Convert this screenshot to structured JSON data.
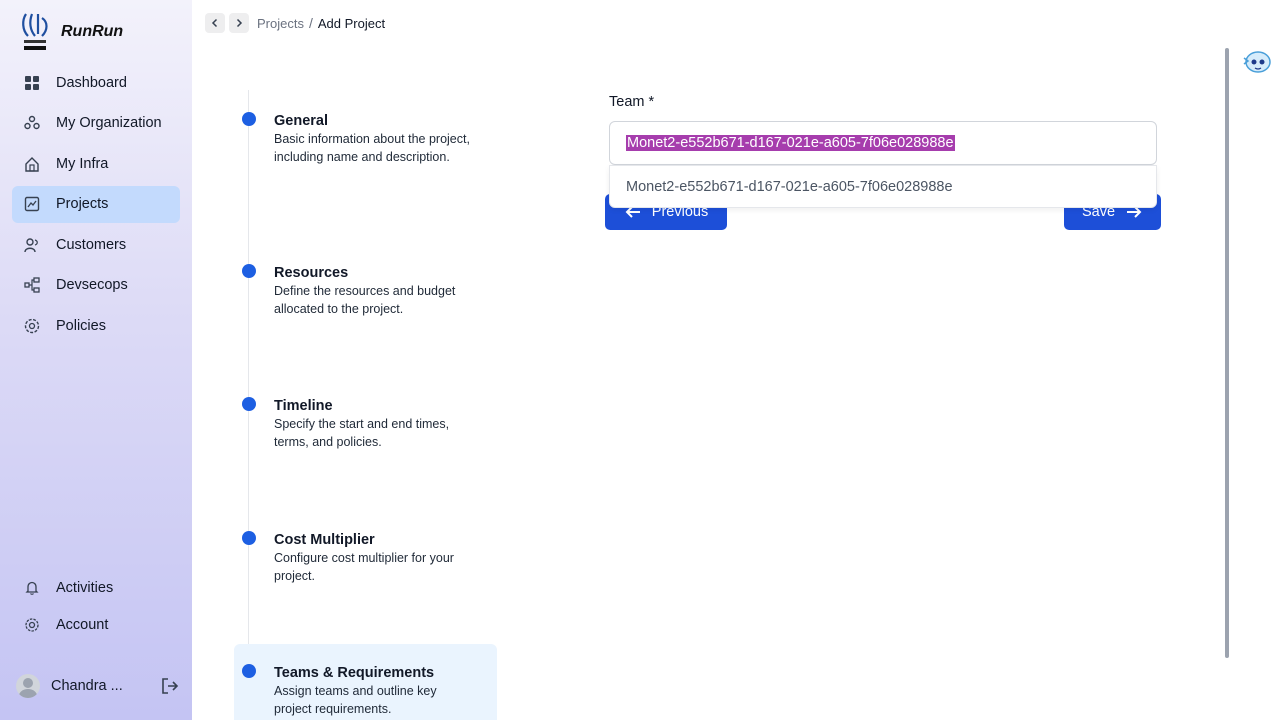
{
  "brand": {
    "name": "RunRun",
    "logo_icon": "railtel-logo-icon"
  },
  "sidebar": {
    "items": [
      {
        "label": "Dashboard",
        "icon": "dashboard-icon",
        "active": false
      },
      {
        "label": "My Organization",
        "icon": "organization-icon",
        "active": false
      },
      {
        "label": "My Infra",
        "icon": "infra-icon",
        "active": false
      },
      {
        "label": "Projects",
        "icon": "projects-icon",
        "active": true
      },
      {
        "label": "Customers",
        "icon": "customers-icon",
        "active": false
      },
      {
        "label": "Devsecops",
        "icon": "devsecops-icon",
        "active": false
      },
      {
        "label": "Policies",
        "icon": "policies-icon",
        "active": false
      }
    ],
    "bottom_items": [
      {
        "label": "Activities",
        "icon": "bell-icon"
      },
      {
        "label": "Account",
        "icon": "gear-icon"
      }
    ],
    "user": {
      "name": "Chandra ...",
      "logout_icon": "logout-icon"
    }
  },
  "breadcrumb": {
    "parent": "Projects",
    "separator": "/",
    "current": "Add Project"
  },
  "steps": [
    {
      "title": "General",
      "description": "Basic information about the project, including name and description."
    },
    {
      "title": "Resources",
      "description": "Define the resources and budget allocated to the project."
    },
    {
      "title": "Timeline",
      "description": "Specify the start and end times, terms, and policies."
    },
    {
      "title": "Cost Multiplier",
      "description": "Configure cost multiplier for your project."
    },
    {
      "title": "Teams & Requirements",
      "description": "Assign teams and outline key project requirements."
    }
  ],
  "form": {
    "team_label": "Team *",
    "team_value": "Monet2-e552b671-d167-021e-a605-7f06e028988e",
    "dropdown_option": "Monet2-e552b671-d167-021e-a605-7f06e028988e",
    "previous_label": "Previous",
    "save_label": "Save"
  },
  "colors": {
    "accent": "#1d4fd8",
    "active_nav": "#c3dafd",
    "selection": "#a63dad",
    "step_dot": "#1d5fe2"
  }
}
